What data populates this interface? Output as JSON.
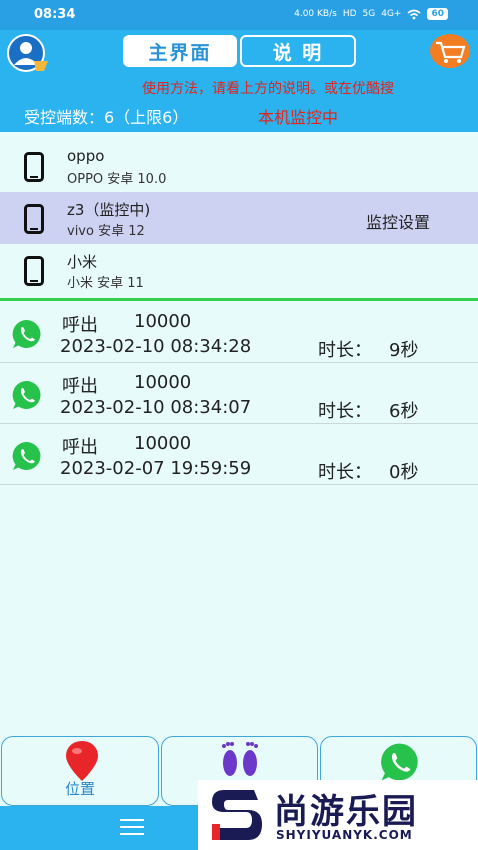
{
  "status_bar": {
    "time": "08:34",
    "network_speed": "4.00 KB/s",
    "hd": "HD",
    "signal_1": "5G",
    "signal_2": "4G+",
    "battery": "60"
  },
  "header": {
    "tabs": [
      {
        "label": "主界面",
        "active": true
      },
      {
        "label": "说 明",
        "active": false
      }
    ],
    "marquee": "使用方法，请看上方的说明。或在优酷搜",
    "controlled_count": "受控端数：6（上限6）",
    "monitor_status": "本机监控中"
  },
  "devices": [
    {
      "name": "oppo",
      "sub": "OPPO 安卓 10.0",
      "action": ""
    },
    {
      "name": "z3（监控中)",
      "sub": "vivo 安卓 12",
      "action": "监控设置",
      "selected": true
    },
    {
      "name": "小米",
      "sub": "小米 安卓 11",
      "action": ""
    }
  ],
  "calls": [
    {
      "type": "呼出",
      "number": "10000",
      "time": "2023-02-10 08:34:28",
      "duration_label": "时长：",
      "duration": "9秒"
    },
    {
      "type": "呼出",
      "number": "10000",
      "time": "2023-02-10 08:34:07",
      "duration_label": "时长：",
      "duration": "6秒"
    },
    {
      "type": "呼出",
      "number": "10000",
      "time": "2023-02-07 19:59:59",
      "duration_label": "时长：",
      "duration": "0秒"
    }
  ],
  "bottom_nav": [
    {
      "label": "位置",
      "icon": "location-pin-icon"
    },
    {
      "label": "",
      "icon": "footprints-icon"
    },
    {
      "label": "",
      "icon": "whatsapp-phone-icon"
    }
  ],
  "watermark": {
    "title": "尚游乐园",
    "url": "SHYIYUANYK.COM"
  },
  "colors": {
    "header": "#2bb3ef",
    "accent_red": "#e2241c",
    "background": "#e8fbfb",
    "selected_row": "#cdd2f2",
    "divider": "#35d04c",
    "whatsapp": "#27c24c"
  }
}
